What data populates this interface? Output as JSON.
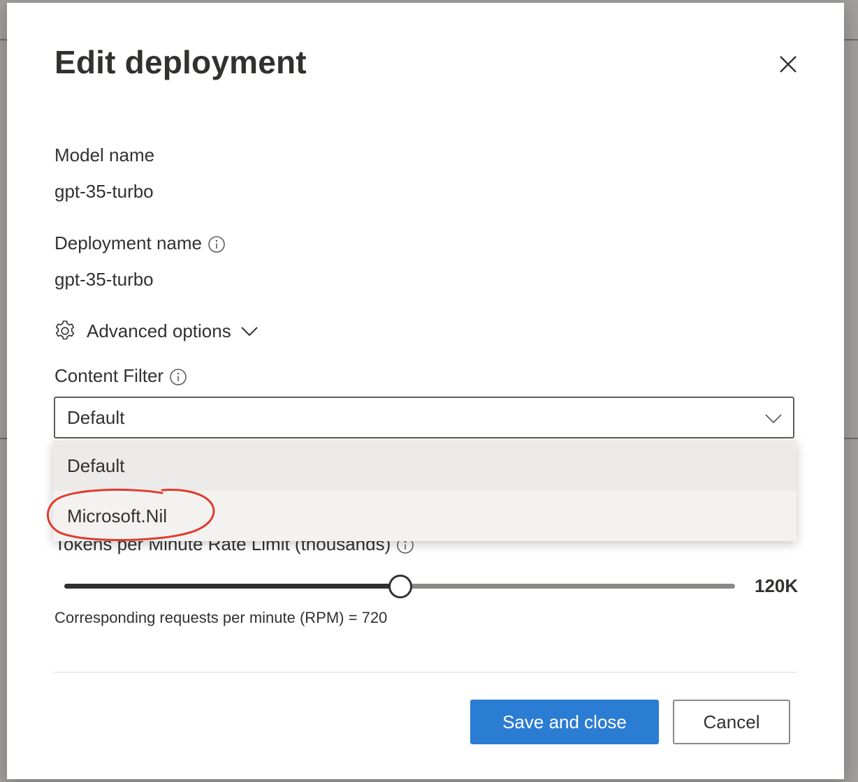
{
  "dialog": {
    "title": "Edit deployment",
    "close_icon": "close-icon"
  },
  "model": {
    "label": "Model name",
    "value": "gpt-35-turbo"
  },
  "deployment": {
    "label": "Deployment name",
    "info_icon": "info-icon",
    "value": "gpt-35-turbo"
  },
  "advanced": {
    "icon": "gear-icon",
    "label": "Advanced options",
    "chevron": "chevron-down-icon"
  },
  "content_filter": {
    "label": "Content Filter",
    "info_icon": "info-icon",
    "selected": "Default",
    "options": [
      {
        "label": "Default",
        "selected": true
      },
      {
        "label": "Microsoft.Nil",
        "selected": false,
        "annotated": true
      }
    ],
    "annotation_color": "#e03c2c"
  },
  "rate_limit": {
    "label": "Tokens per Minute Rate Limit (thousands)",
    "info_icon": "info-icon",
    "value_label": "120K",
    "slider_fraction": 0.5,
    "rpm_text": "Corresponding requests per minute (RPM) = 720"
  },
  "footer": {
    "save_label": "Save and close",
    "cancel_label": "Cancel"
  },
  "colors": {
    "primary": "#2b7cd3",
    "text": "#323130"
  }
}
